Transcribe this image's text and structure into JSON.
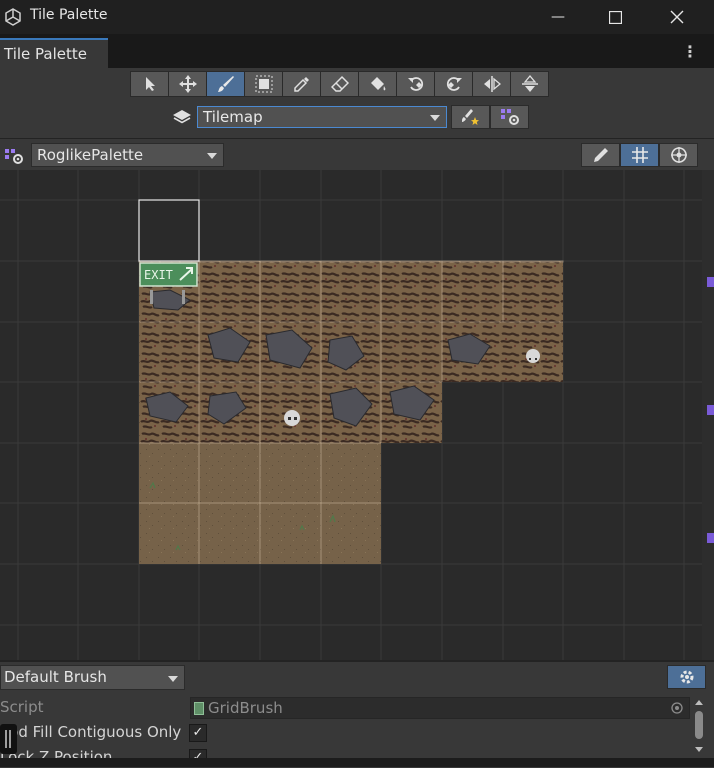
{
  "window": {
    "title": "Tile Palette",
    "minimize": "—",
    "maximize": "☐",
    "close": "✕"
  },
  "tab": {
    "label": "Tile Palette",
    "menu": "⋮"
  },
  "toolbar": {
    "tools": [
      {
        "name": "select-tool",
        "icon": "arrow-icon"
      },
      {
        "name": "move-tool",
        "icon": "move-icon"
      },
      {
        "name": "paint-tool",
        "icon": "brush-icon",
        "active": true
      },
      {
        "name": "box-fill-tool",
        "icon": "box-fill-icon"
      },
      {
        "name": "pick-tool",
        "icon": "eyedropper-icon"
      },
      {
        "name": "erase-tool",
        "icon": "eraser-icon"
      },
      {
        "name": "fill-tool",
        "icon": "bucket-icon"
      },
      {
        "name": "rotate-ccw-tool",
        "icon": "rotate-ccw-icon"
      },
      {
        "name": "rotate-cw-tool",
        "icon": "rotate-cw-icon"
      },
      {
        "name": "flip-x-tool",
        "icon": "flip-x-icon"
      },
      {
        "name": "flip-y-tool",
        "icon": "flip-y-icon"
      }
    ],
    "active_target": "Tilemap"
  },
  "palette": {
    "selected": "RoglikePalette",
    "edit_icon": "pencil-icon",
    "grid_icon": "grid-icon",
    "gizmo_icon": "gizmo-icon"
  },
  "tiles": {
    "exit_sign": "EXIT"
  },
  "brush": {
    "selected": "Default Brush",
    "settings_icon": "gear-icon",
    "properties": {
      "script_label": "Script",
      "script_value": "GridBrush",
      "flood_fill_label": "ood Fill Contiguous Only",
      "flood_fill_checked": "✓",
      "lock_z_label": "Lock Z Position",
      "lock_z_checked": "✓"
    }
  },
  "colors": {
    "accent": "#4d6f97",
    "panel": "#383838",
    "grid_bg": "#2a2a2a",
    "dirt": "#7a6348",
    "floor": "#766249"
  }
}
